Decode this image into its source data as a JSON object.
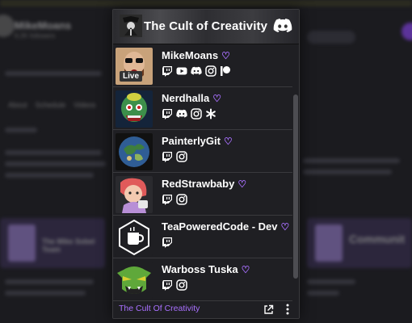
{
  "background": {
    "channel_name": "MikeMoans",
    "channel_sub": "6.2K followers",
    "tabs": [
      "About",
      "Schedule",
      "Videos"
    ],
    "card_left": "The Mike Sobel Team",
    "card_right": "Communit"
  },
  "widget": {
    "title": "The Cult of Creativity",
    "footer": "The Cult Of Creativity",
    "members": [
      {
        "name": "MikeMoans",
        "live": "Live",
        "links": [
          "twitch-icon",
          "youtube-icon",
          "discord-icon",
          "instagram-icon",
          "patreon-icon"
        ]
      },
      {
        "name": "Nerdhalla",
        "links": [
          "twitch-icon",
          "discord-icon",
          "instagram-icon",
          "asterisk-icon"
        ]
      },
      {
        "name": "PainterlyGit",
        "links": [
          "twitch-icon",
          "instagram-icon"
        ]
      },
      {
        "name": "RedStrawbaby",
        "links": [
          "twitch-icon",
          "instagram-icon"
        ]
      },
      {
        "name": "TeaPoweredCode - Dev",
        "links": [
          "twitch-icon"
        ]
      },
      {
        "name": "Warboss Tuska",
        "links": [
          "twitch-icon",
          "instagram-icon"
        ]
      }
    ]
  },
  "colors": {
    "accent": "#a970ff",
    "panel": "#1f1f23",
    "live_badge": "#333333"
  }
}
